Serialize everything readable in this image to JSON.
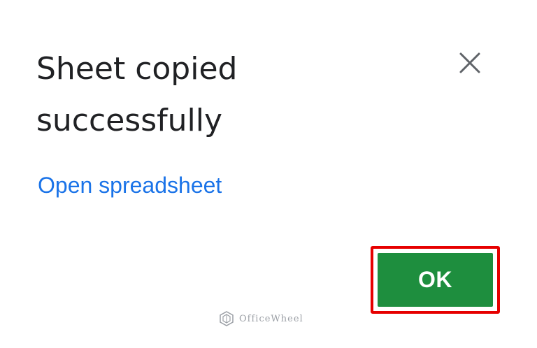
{
  "dialog": {
    "title": "Sheet copied successfully",
    "link_label": "Open spreadsheet",
    "ok_label": "OK",
    "close_icon": "close-icon"
  },
  "watermark": {
    "text": "OfficeWheel",
    "logo_icon": "hexagon-logo-icon"
  },
  "colors": {
    "link": "#1a73e8",
    "ok_button": "#1e8e3e",
    "highlight_outline": "#e60000",
    "title_text": "#202124"
  }
}
